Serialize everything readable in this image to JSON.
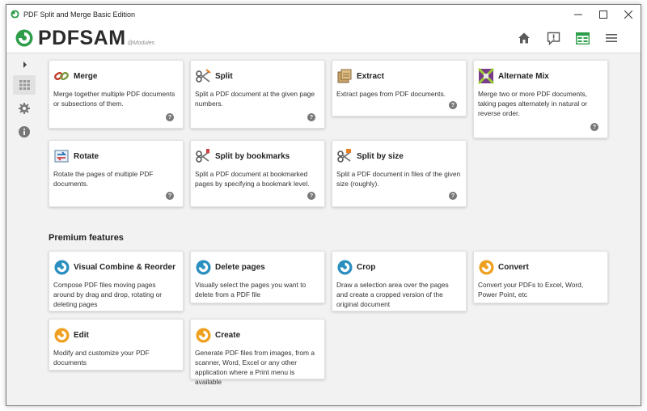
{
  "window": {
    "title": "PDF Split and Merge Basic Edition",
    "minimize_icon": "minimize-icon",
    "maximize_icon": "maximize-icon",
    "close_icon": "close-icon"
  },
  "header": {
    "logo_text": "PDFSAM",
    "logo_sub": "@Modules",
    "actions": [
      "home-icon",
      "news-icon",
      "modules-icon",
      "menu-icon"
    ]
  },
  "sidebar": {
    "items": [
      "expand-icon",
      "modules-icon",
      "settings-icon",
      "about-icon"
    ]
  },
  "modules": [
    {
      "id": "merge",
      "title": "Merge",
      "description": "Merge together multiple PDF documents or subsections of them.",
      "icon": "merge-icon"
    },
    {
      "id": "split",
      "title": "Split",
      "description": "Split a PDF document at the given page numbers.",
      "icon": "split-icon"
    },
    {
      "id": "extract",
      "title": "Extract",
      "description": "Extract pages from PDF documents.",
      "icon": "extract-icon"
    },
    {
      "id": "alternate-mix",
      "title": "Alternate Mix",
      "description": "Merge two or more PDF documents, taking pages alternately in natural or reverse order.",
      "icon": "alternate-mix-icon"
    },
    {
      "id": "rotate",
      "title": "Rotate",
      "description": "Rotate the pages of multiple PDF documents.",
      "icon": "rotate-icon"
    },
    {
      "id": "split-by-bookmarks",
      "title": "Split by bookmarks",
      "description": "Split a PDF document at bookmarked pages by specifying a bookmark level.",
      "icon": "split-bookmarks-icon"
    },
    {
      "id": "split-by-size",
      "title": "Split by size",
      "description": "Split a PDF document in files of the given size (roughly).",
      "icon": "split-size-icon"
    }
  ],
  "premium": {
    "title": "Premium features",
    "items": [
      {
        "id": "visual-combine",
        "title": "Visual Combine & Reorder",
        "description": "Compose PDF files moving pages around by drag and drop, rotating or deleting pages",
        "icon": "pdfsam-blue-icon"
      },
      {
        "id": "delete-pages",
        "title": "Delete pages",
        "description": "Visually select the pages you want to delete from a PDF file",
        "icon": "pdfsam-blue-icon"
      },
      {
        "id": "crop",
        "title": "Crop",
        "description": "Draw a selection area over the pages and create a cropped version of the original document",
        "icon": "pdfsam-blue-icon"
      },
      {
        "id": "convert",
        "title": "Convert",
        "description": "Convert your PDFs to Excel, Word, Power Point, etc",
        "icon": "pdfsam-orange-icon"
      },
      {
        "id": "edit",
        "title": "Edit",
        "description": "Modify and customize your PDF documents",
        "icon": "pdfsam-orange-icon"
      },
      {
        "id": "create",
        "title": "Create",
        "description": "Generate PDF files from images, from a scanner, Word, Excel or any other application where a Print menu is available",
        "icon": "pdfsam-orange-icon"
      }
    ]
  },
  "help_symbol": "?",
  "colors": {
    "accent_green": "#2e9e4a",
    "premium_blue": "#2a8fbf",
    "premium_orange": "#f0a020"
  }
}
